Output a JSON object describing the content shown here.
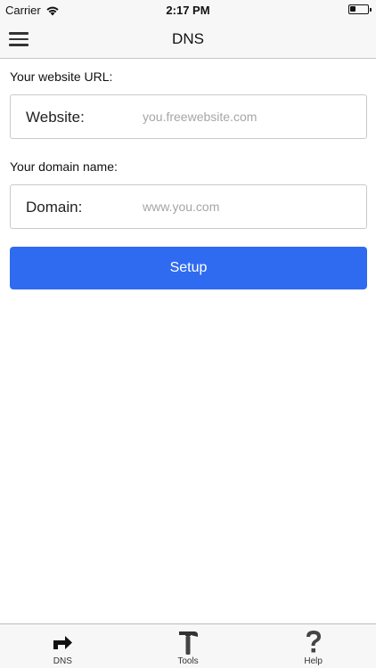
{
  "status_bar": {
    "carrier": "Carrier",
    "time": "2:17 PM",
    "battery_level": 0.35
  },
  "nav": {
    "title": "DNS",
    "menu_icon": "hamburger-menu-icon"
  },
  "form": {
    "website_section_label": "Your website URL:",
    "website_label": "Website:",
    "website_value": "",
    "website_placeholder": "you.freewebsite.com",
    "domain_section_label": "Your domain name:",
    "domain_label": "Domain:",
    "domain_value": "",
    "domain_placeholder": "www.you.com",
    "setup_label": "Setup"
  },
  "tabs": [
    {
      "label": "DNS",
      "icon": "share-arrow-icon",
      "selected": true
    },
    {
      "label": "Tools",
      "icon": "hammer-icon",
      "selected": false
    },
    {
      "label": "Help",
      "icon": "question-mark-icon",
      "selected": false
    }
  ],
  "colors": {
    "accent": "#2f6bf0",
    "bar_background": "#f7f7f7",
    "placeholder": "#a6a6a6"
  }
}
